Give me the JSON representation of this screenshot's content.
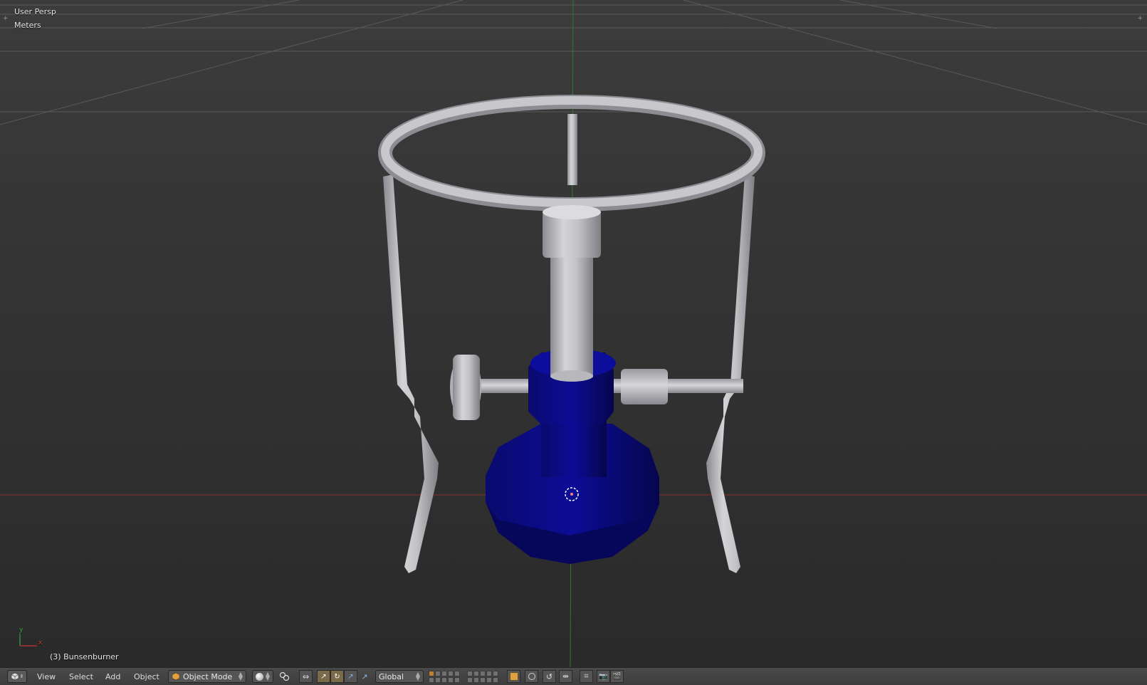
{
  "viewport": {
    "view_name": "User Persp",
    "units": "Meters",
    "active_object": "(3) Bunsenburner",
    "axis_labels": {
      "x": "x",
      "y": "y"
    },
    "colors": {
      "x_axis": "#a03030",
      "y_axis": "#2e8b2e",
      "burner_blue": "#0a0a8a",
      "metal": "#b8b8bc"
    }
  },
  "header": {
    "editor_type_icon": "3d-view-cube-icon",
    "menus": [
      "View",
      "Select",
      "Add",
      "Object"
    ],
    "mode": "Object Mode",
    "mode_icon": "object-mode-cube-icon",
    "shading_icon": "solid-sphere-icon",
    "pivot_icon": "pivot-point-icon",
    "manipulator_icons": [
      "manipulator-toggle-icon",
      "translate-icon",
      "rotate-icon",
      "scale-icon"
    ],
    "orientation": "Global",
    "layers_first_group_active": 0,
    "tool_icons": [
      "lock-camera-icon",
      "proportional-edit-icon",
      "snap-icon",
      "snap-target-icon",
      "opengl-render-icon",
      "opengl-animation-icon"
    ]
  }
}
